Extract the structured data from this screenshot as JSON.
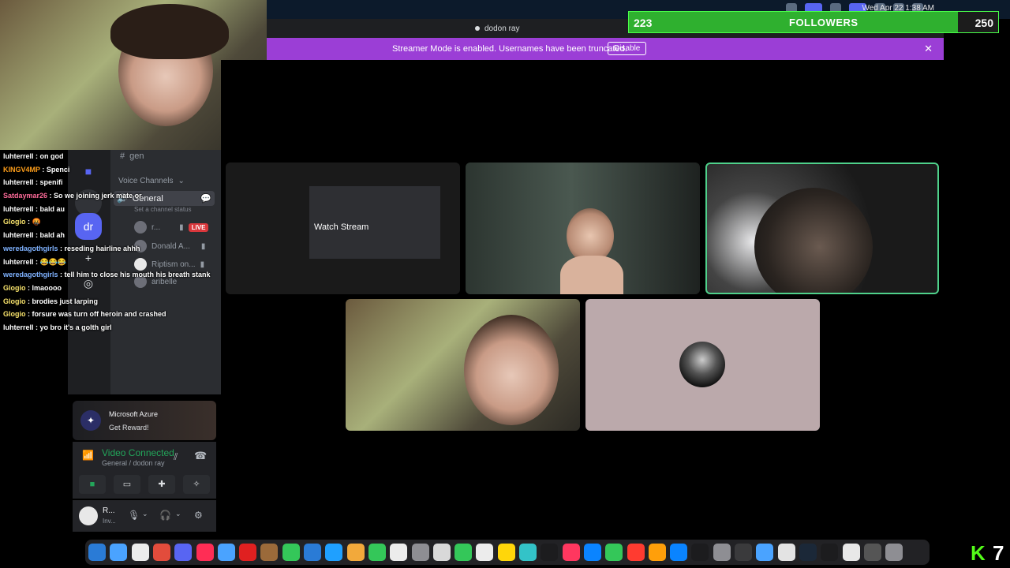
{
  "menubar": {
    "clock": "Wed Apr 22  1:38 AM"
  },
  "titlebar": {
    "title": "dodon ray"
  },
  "banner": {
    "message": "Streamer Mode is enabled. Usernames have been truncated.",
    "disable_label": "Disable",
    "close_icon": "close-icon"
  },
  "followers": {
    "current": "223",
    "label": "FOLLOWERS",
    "goal": "250",
    "progress": 0.892
  },
  "sidebar": {
    "text_channel": "gen",
    "voice_header": "Voice Channels",
    "voice_channel": "General",
    "status_prompt": "Set a channel status",
    "members": [
      {
        "name": "r...",
        "badge": "LIVE"
      },
      {
        "name": "Donald A..."
      },
      {
        "name": "Riptism on..."
      },
      {
        "name": "aribelle"
      }
    ]
  },
  "chat": [
    {
      "user": "luhterrell",
      "color": "#ffffff",
      "text": "on god"
    },
    {
      "user": "KINGV4MP",
      "color": "#ff9f1a",
      "text": "Spenci"
    },
    {
      "user": "luhterrell",
      "color": "#ffffff",
      "text": "spenifi"
    },
    {
      "user": "Satdaymar26",
      "color": "#ff6b9a",
      "text": "So we joining jerk mate or"
    },
    {
      "user": "luhterrell",
      "color": "#ffffff",
      "text": "bald au"
    },
    {
      "user": "Glogio",
      "color": "#f7e26b",
      "text": "🤬"
    },
    {
      "user": "luhterrell",
      "color": "#ffffff",
      "text": "bald ah"
    },
    {
      "user": "weredagothgirls",
      "color": "#7fb2ff",
      "text": "reseding hairline ahhh"
    },
    {
      "user": "luhterrell",
      "color": "#ffffff",
      "text": "😂😂😂"
    },
    {
      "user": "weredagothgirls",
      "color": "#7fb2ff",
      "text": "tell him to close his mouth his breath stank"
    },
    {
      "user": "Glogio",
      "color": "#f7e26b",
      "text": "lmaoooo"
    },
    {
      "user": "Glogio",
      "color": "#f7e26b",
      "text": "brodies just larping"
    },
    {
      "user": "Glogio",
      "color": "#f7e26b",
      "text": "forsure was turn off heroin and crashed"
    },
    {
      "user": "luhterrell",
      "color": "#ffffff",
      "text": "yo bro it's a golth girl"
    }
  ],
  "promo": {
    "title": "Microsoft Azure",
    "action": "Get Reward!"
  },
  "voice": {
    "status": "Video Connected",
    "channel": "General / dodon ray"
  },
  "user": {
    "name": "R...",
    "status": "Inv..."
  },
  "stage": {
    "watch_stream": "Watch Stream"
  },
  "kick": {
    "count": "7"
  },
  "colors": {
    "accent": "#5865f2",
    "banner": "#9b3ed6",
    "speaking": "#4fd18b",
    "live": "#da373c"
  }
}
